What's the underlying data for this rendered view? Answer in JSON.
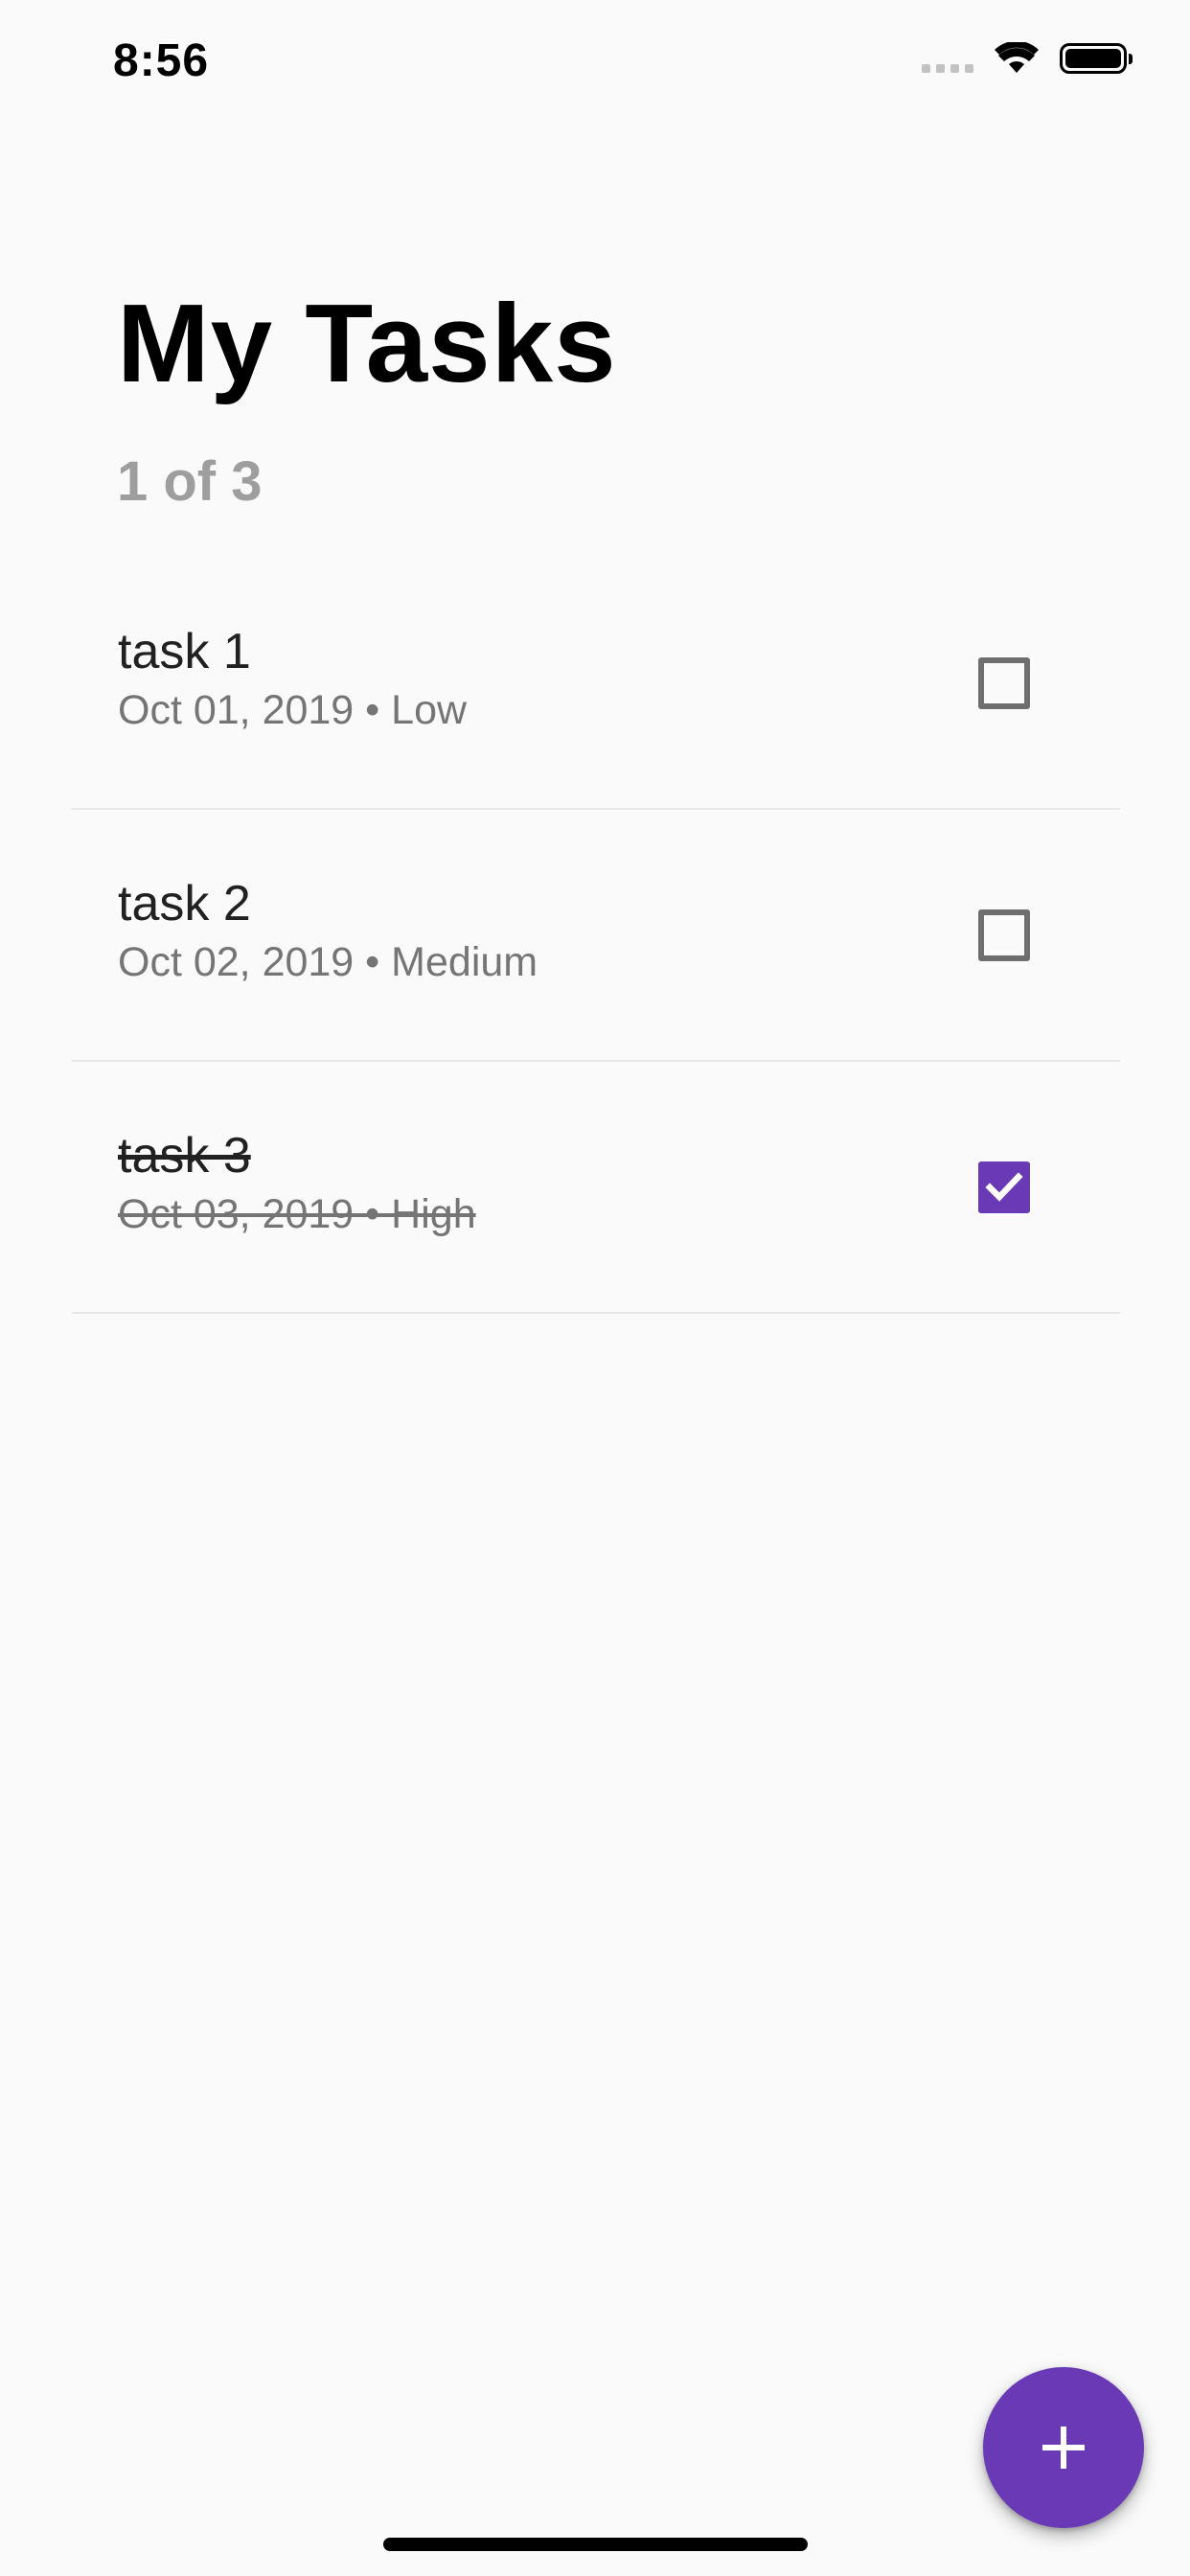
{
  "status_bar": {
    "time": "8:56",
    "icons": [
      "cellular-signal-icon",
      "wifi-icon",
      "battery-icon"
    ]
  },
  "header": {
    "title": "My Tasks",
    "subtitle": "1 of 3"
  },
  "tasks": [
    {
      "title": "task 1",
      "meta": "Oct 01, 2019 • Low",
      "completed": false
    },
    {
      "title": "task 2",
      "meta": "Oct 02, 2019 • Medium",
      "completed": false
    },
    {
      "title": "task 3",
      "meta": "Oct 03, 2019 • High",
      "completed": true
    }
  ],
  "fab": {
    "icon": "plus-icon"
  },
  "colors": {
    "accent": "#6a3ab6",
    "background": "#fafafa",
    "subtitle": "#9e9e9e",
    "meta_text": "#757575",
    "divider": "#e8e8e8"
  }
}
